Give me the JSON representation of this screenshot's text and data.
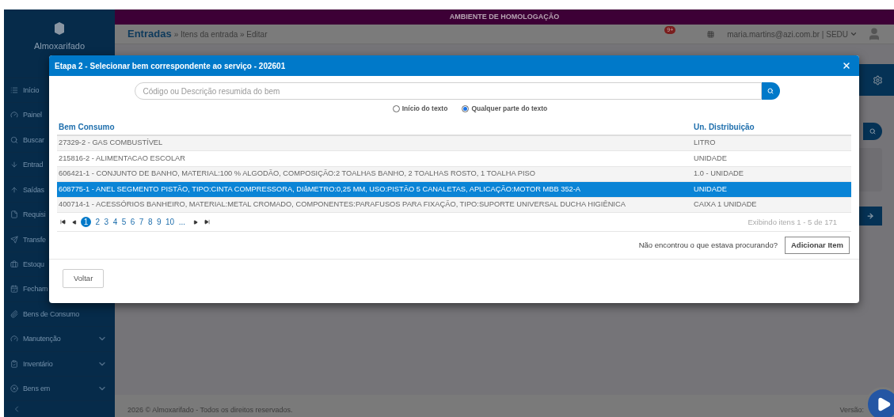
{
  "sidebar": {
    "brand": "Almoxarifado",
    "items": [
      {
        "label": "Início",
        "kind": "link"
      },
      {
        "label": "Painel",
        "kind": "link"
      },
      {
        "label": "Buscar",
        "kind": "link"
      },
      {
        "label": "Entrad",
        "kind": "link"
      },
      {
        "label": "Saídas",
        "kind": "link"
      },
      {
        "label": "Requisi",
        "kind": "link"
      },
      {
        "label": "Transfe",
        "kind": "link"
      },
      {
        "label": "Estoqu",
        "kind": "link"
      },
      {
        "label": "Fecham",
        "kind": "link"
      },
      {
        "label": "Bens de Consumo",
        "kind": "link"
      },
      {
        "label": "Manutenção",
        "kind": "group"
      },
      {
        "label": "Inventário",
        "kind": "group"
      },
      {
        "label": "Bens em",
        "kind": "group"
      }
    ]
  },
  "header": {
    "environment": "AMBIENTE DE HOMOLOGAÇÃO",
    "section": "Entradas",
    "breadcrumb": "» Itens da entrada » Editar",
    "notifications": "9+",
    "user": "maria.martins@azi.com.br | SEDU"
  },
  "footer": {
    "copyright": "2026 © Almoxarifado - Todos os direitos reservados.",
    "version": "Versão:"
  },
  "modal": {
    "title": "Etapa 2 - Selecionar bem correspondente ao serviço - 202601",
    "search": {
      "placeholder": "Código ou Descrição resumida do bem"
    },
    "search_modes": [
      {
        "label": "Início do texto",
        "selected": false
      },
      {
        "label": "Qualquer parte do texto",
        "selected": true
      }
    ],
    "columns": [
      "Bem Consumo",
      "Un. Distribuição"
    ],
    "rows": [
      {
        "item": "27329-2 - GAS COMBUSTÍVEL",
        "unit": "LITRO",
        "selected": false
      },
      {
        "item": "215816-2 - ALIMENTACAO ESCOLAR",
        "unit": "UNIDADE",
        "selected": false
      },
      {
        "item": "606421-1 - CONJUNTO DE BANHO, MATERIAL:100 % ALGODÃO, COMPOSIÇÃO:2 TOALHAS BANHO, 2 TOALHAS ROSTO, 1 TOALHA PISO",
        "unit": "1.0 - UNIDADE",
        "selected": false
      },
      {
        "item": "608775-1 - ANEL SEGMENTO PISTÃO, TIPO:CINTA COMPRESSORA, DIâMETRO:0,25 MM, USO:PISTÃO 5 CANALETAS, APLICAÇÃO:MOTOR MBB 352-A",
        "unit": "UNIDADE",
        "selected": true
      },
      {
        "item": "400714-1 - ACESSÓRIOS BANHEIRO, MATERIAL:METAL CROMADO, COMPONENTES:PARAFUSOS PARA FIXAÇÃO, TIPO:SUPORTE UNIVERSAL DUCHA HIGIÊNICA",
        "unit": "CAIXA 1 UNIDADE",
        "selected": false
      }
    ],
    "pages": [
      {
        "label": "1",
        "selected": true
      },
      {
        "label": "2",
        "selected": false
      },
      {
        "label": "3",
        "selected": false
      },
      {
        "label": "4",
        "selected": false
      },
      {
        "label": "5",
        "selected": false
      },
      {
        "label": "6",
        "selected": false
      },
      {
        "label": "7",
        "selected": false
      },
      {
        "label": "8",
        "selected": false
      },
      {
        "label": "9",
        "selected": false
      },
      {
        "label": "10",
        "selected": false
      },
      {
        "label": "...",
        "selected": false
      }
    ],
    "summary": "Exibindo itens 1 - 5 de 171",
    "not_found": "Não encontrou o que estava procurando?",
    "add_button": "Adicionar Item",
    "back_button": "Voltar"
  }
}
